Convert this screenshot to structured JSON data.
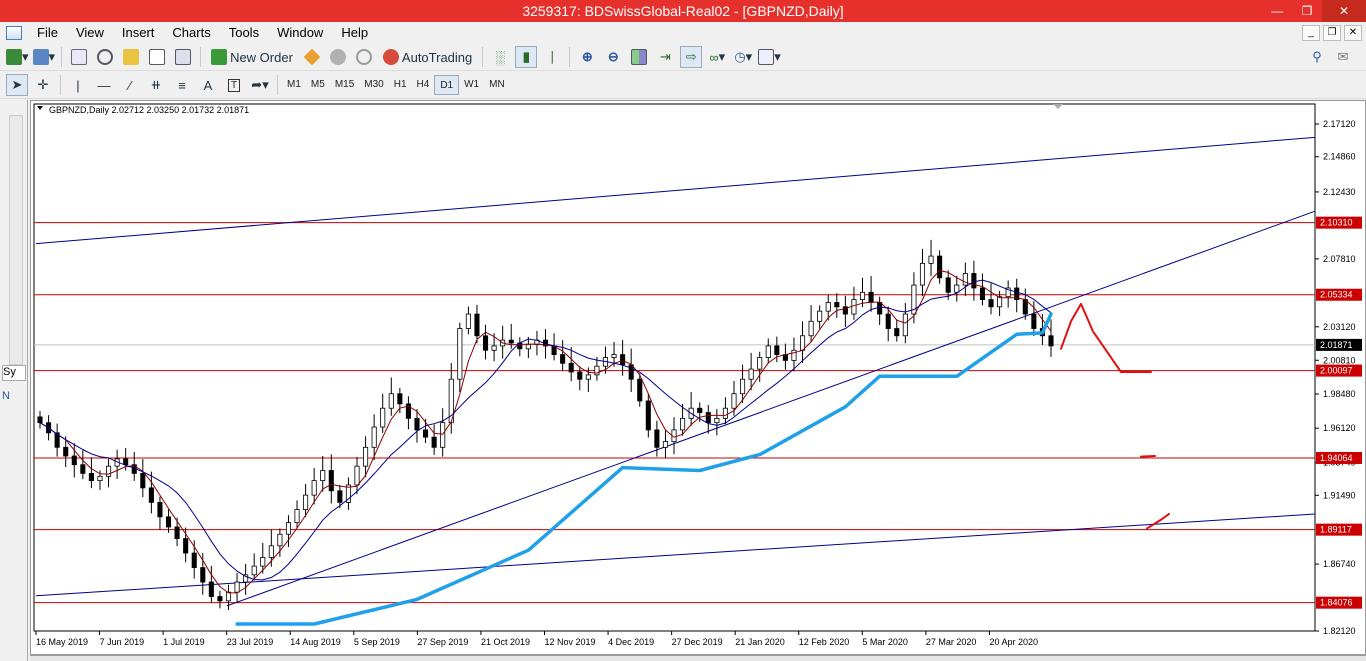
{
  "window": {
    "title": "3259317: BDSwissGlobal-Real02 - [GBPNZD,Daily]"
  },
  "menu": {
    "items": [
      "File",
      "View",
      "Insert",
      "Charts",
      "Tools",
      "Window",
      "Help"
    ]
  },
  "toolbar": {
    "new_order_label": "New Order",
    "autotrading_label": "AutoTrading",
    "timeframes": [
      "M1",
      "M5",
      "M15",
      "M30",
      "H1",
      "H4",
      "D1",
      "W1",
      "MN"
    ],
    "active_timeframe": "D1",
    "text_tool_label": "A"
  },
  "left_panel": {
    "tab1": "Sy",
    "tab2": "N"
  },
  "chart_data": {
    "type": "candlestick",
    "symbol_info": "GBPNZD,Daily  2.02712 2.03250 2.01732 2.01871",
    "ylim": [
      1.8212,
      2.185
    ],
    "y_ticks": [
      2.1712,
      2.1486,
      2.1243,
      2.0781,
      2.0312,
      2.0081,
      1.9848,
      1.9612,
      1.9374,
      1.9149,
      1.8674,
      1.8212
    ],
    "y_tick_labels": [
      "2.17120",
      "2.14860",
      "2.12430",
      "2.07810",
      "2.03120",
      "2.00810",
      "1.98480",
      "1.96120",
      "1.93740",
      "1.91490",
      "1.86740",
      "1.82120"
    ],
    "price_levels": [
      {
        "value": 2.1031,
        "label": "2.10310",
        "color": "#cc0000"
      },
      {
        "value": 2.05334,
        "label": "2.05334",
        "color": "#cc0000"
      },
      {
        "value": 2.00097,
        "label": "2.00097",
        "color": "#cc0000"
      },
      {
        "value": 1.94064,
        "label": "1.94064",
        "color": "#cc0000"
      },
      {
        "value": 1.89117,
        "label": "1.89117",
        "color": "#cc0000"
      },
      {
        "value": 1.84076,
        "label": "1.84076",
        "color": "#cc0000"
      }
    ],
    "current_price": {
      "value": 2.01871,
      "label": "2.01871"
    },
    "x_labels": [
      "16 May 2019",
      "7 Jun 2019",
      "1 Jul 2019",
      "23 Jul 2019",
      "14 Aug 2019",
      "5 Sep 2019",
      "27 Sep 2019",
      "21 Oct 2019",
      "12 Nov 2019",
      "4 Dec 2019",
      "27 Dec 2019",
      "21 Jan 2020",
      "12 Feb 2020",
      "5 Mar 2020",
      "27 Mar 2020",
      "20 Apr 2020"
    ],
    "closes": [
      1.965,
      1.958,
      1.948,
      1.942,
      1.936,
      1.93,
      1.925,
      1.928,
      1.935,
      1.94,
      1.936,
      1.93,
      1.92,
      1.91,
      1.9,
      1.893,
      1.885,
      1.875,
      1.865,
      1.855,
      1.845,
      1.842,
      1.848,
      1.855,
      1.86,
      1.866,
      1.872,
      1.88,
      1.888,
      1.896,
      1.905,
      1.915,
      1.925,
      1.932,
      1.918,
      1.91,
      1.922,
      1.935,
      1.948,
      1.962,
      1.975,
      1.985,
      1.978,
      1.968,
      1.96,
      1.955,
      1.948,
      1.965,
      1.995,
      2.03,
      2.04,
      2.025,
      2.015,
      2.018,
      2.022,
      2.02,
      2.016,
      2.019,
      2.022,
      2.018,
      2.012,
      2.006,
      2.0,
      1.995,
      1.998,
      2.004,
      2.01,
      2.012,
      2.005,
      1.995,
      1.98,
      1.96,
      1.948,
      1.952,
      1.96,
      1.968,
      1.975,
      1.972,
      1.965,
      1.968,
      1.975,
      1.985,
      1.995,
      2.002,
      2.01,
      2.018,
      2.012,
      2.008,
      2.015,
      2.025,
      2.035,
      2.042,
      2.048,
      2.045,
      2.04,
      2.05,
      2.055,
      2.048,
      2.04,
      2.03,
      2.025,
      2.04,
      2.06,
      2.075,
      2.08,
      2.065,
      2.055,
      2.06,
      2.068,
      2.058,
      2.05,
      2.045,
      2.052,
      2.058,
      2.05,
      2.04,
      2.03,
      2.025,
      2.018
    ],
    "trend_lines": [
      {
        "from": [
          "16 May 2019",
          2.0886
        ],
        "to": [
          "right-edge",
          2.162
        ],
        "color": "#00008b"
      },
      {
        "from": [
          "23 Jul 2019",
          1.8385
        ],
        "to": [
          "right-edge",
          2.111
        ],
        "color": "#00008b"
      },
      {
        "from": [
          "16 May 2019",
          1.8455
        ],
        "to": [
          "right-edge",
          1.902
        ],
        "color": "#00008b"
      }
    ],
    "ma_colors": [
      "#8b0000",
      "#00008b"
    ],
    "drawings": [
      {
        "color": "#1fa0e8",
        "label": "projection"
      },
      {
        "color": "#e01010",
        "label": "forecast"
      }
    ],
    "grid": false,
    "background": "#ffffff"
  }
}
